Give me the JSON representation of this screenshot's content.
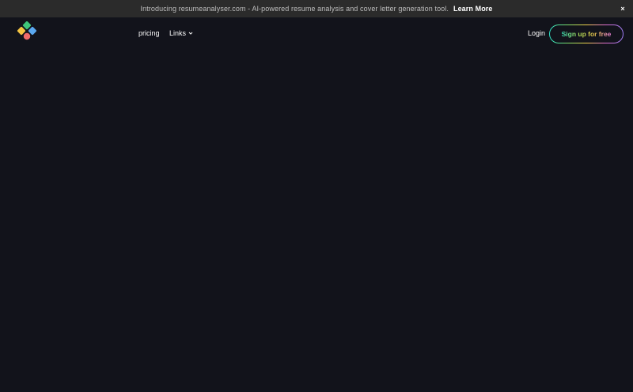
{
  "announcement": {
    "text": "Introducing resumeanalyser.com - AI-powered resume analysis and cover letter generation tool.",
    "link_label": "Learn More",
    "close_label": "×"
  },
  "nav": {
    "items": [
      {
        "label": "pricing"
      },
      {
        "label": "Links"
      }
    ],
    "login_label": "Login",
    "signup_label": "Sign up for free"
  },
  "colors": {
    "background": "#12131b",
    "banner": "#2b2b2b",
    "logo_green": "#3fc57a",
    "logo_yellow": "#f5c542",
    "logo_blue": "#5aa8f0",
    "logo_red": "#f06a6a"
  }
}
